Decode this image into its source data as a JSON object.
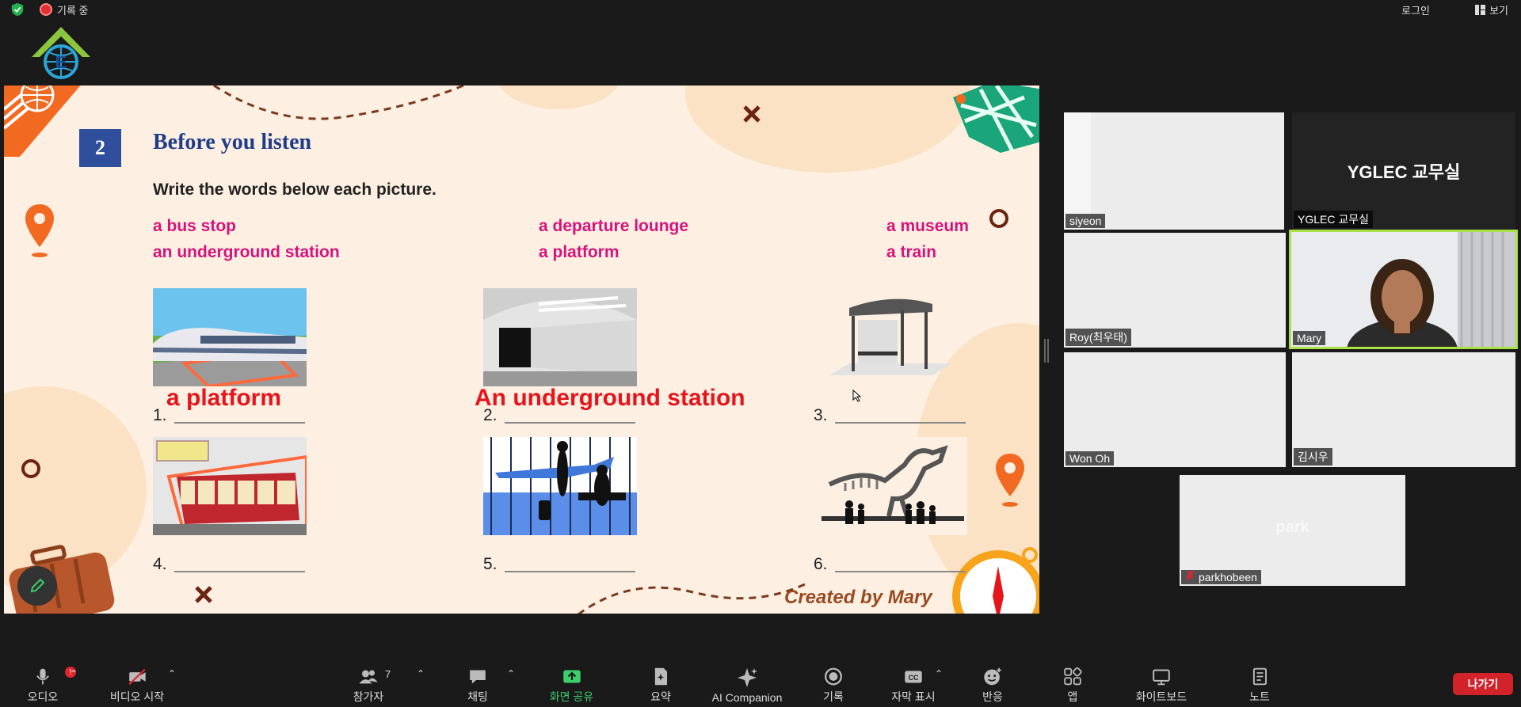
{
  "topbar": {
    "recording_label": "기록 중",
    "login_label": "로그인",
    "view_label": "보기"
  },
  "slide": {
    "number": "2",
    "title": "Before you listen",
    "instruction": "Write the words below each picture.",
    "words": [
      "a bus stop",
      "an underground station",
      "a departure lounge",
      "a platform",
      "a museum",
      "a train"
    ],
    "numbers": [
      "1.",
      "2.",
      "3.",
      "4.",
      "5.",
      "6."
    ],
    "answers": [
      "a platform",
      "An underground station"
    ],
    "credit": "Created by Mary"
  },
  "gallery": {
    "tiles": [
      {
        "name": "siyeon"
      },
      {
        "name": "YGLEC 교무실",
        "display": "YGLEC 교무실"
      },
      {
        "name": "Roy(최우태)"
      },
      {
        "name": "Mary"
      },
      {
        "name": "Won Oh"
      },
      {
        "name": "김시우"
      },
      {
        "name": "parkhobeen",
        "display": "park"
      }
    ]
  },
  "toolbar": {
    "audio": "오디오",
    "video": "비디오 시작",
    "participants": "참가자",
    "participants_count": "7",
    "chat": "채팅",
    "share": "화면 공유",
    "summary": "요약",
    "ai": "AI Companion",
    "record": "기록",
    "captions": "자막 표시",
    "reactions": "반응",
    "apps": "앱",
    "whiteboard": "화이트보드",
    "notes": "노트",
    "leave": "나가기",
    "audio_badge": "!"
  },
  "colors": {
    "active_speaker": "#a9e044",
    "share_green": "#3ccf6b",
    "leave_red": "#d2232a",
    "word_magenta": "#d6137c",
    "answer_red": "#e6141b",
    "title_blue": "#1f3c88"
  }
}
